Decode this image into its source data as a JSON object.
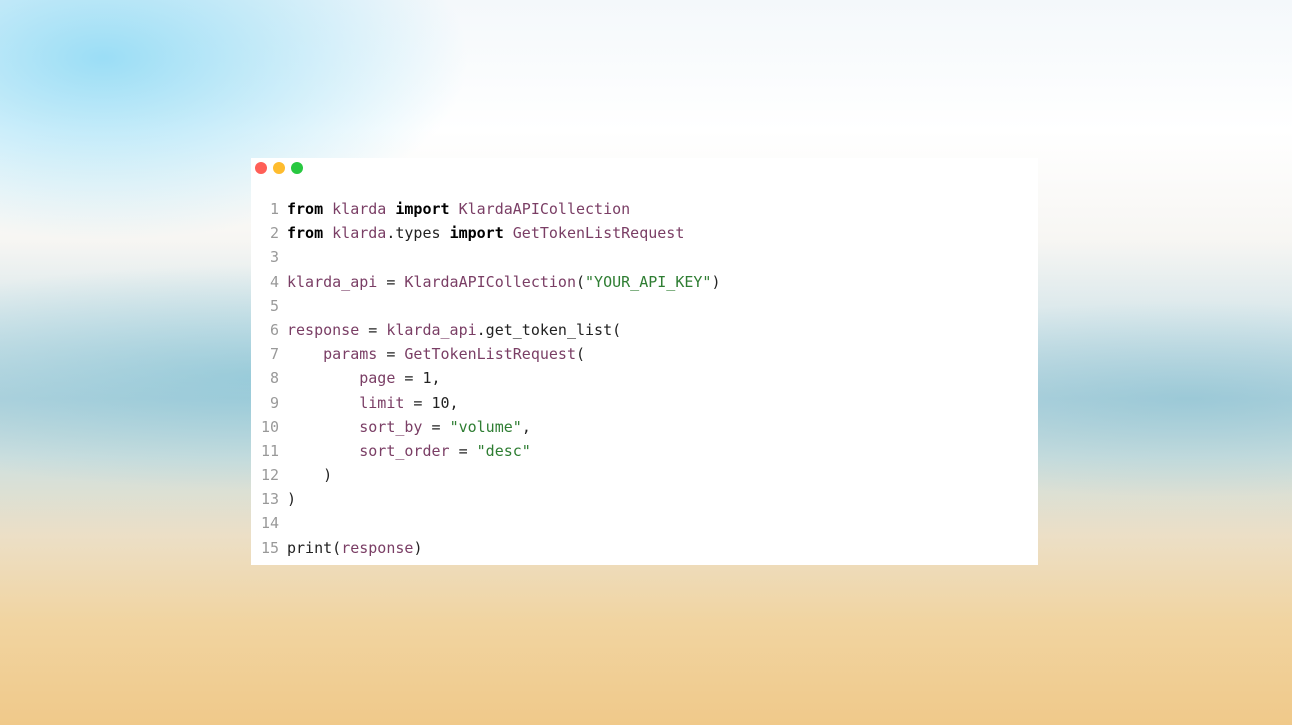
{
  "window": {
    "controls": [
      {
        "name": "close",
        "color": "#ff5f57"
      },
      {
        "name": "minimize",
        "color": "#febc2e"
      },
      {
        "name": "maximize",
        "color": "#28c840"
      }
    ]
  },
  "code": {
    "lines": [
      {
        "n": "1",
        "tokens": [
          [
            "kw",
            "from"
          ],
          [
            "pl",
            " "
          ],
          [
            "id",
            "klarda"
          ],
          [
            "pl",
            " "
          ],
          [
            "kw",
            "import"
          ],
          [
            "pl",
            " "
          ],
          [
            "id",
            "KlardaAPICollection"
          ]
        ]
      },
      {
        "n": "2",
        "tokens": [
          [
            "kw",
            "from"
          ],
          [
            "pl",
            " "
          ],
          [
            "id",
            "klarda"
          ],
          [
            "pl",
            ".types "
          ],
          [
            "kw",
            "import"
          ],
          [
            "pl",
            " "
          ],
          [
            "id",
            "GetTokenListRequest"
          ]
        ]
      },
      {
        "n": "3",
        "tokens": []
      },
      {
        "n": "4",
        "tokens": [
          [
            "id",
            "klarda_api"
          ],
          [
            "pl",
            " = "
          ],
          [
            "id",
            "KlardaAPICollection"
          ],
          [
            "pl",
            "("
          ],
          [
            "str",
            "\"YOUR_API_KEY\""
          ],
          [
            "pl",
            ")"
          ]
        ]
      },
      {
        "n": "5",
        "tokens": []
      },
      {
        "n": "6",
        "tokens": [
          [
            "id",
            "response"
          ],
          [
            "pl",
            " = "
          ],
          [
            "id",
            "klarda_api"
          ],
          [
            "pl",
            ".get_token_list("
          ]
        ]
      },
      {
        "n": "7",
        "tokens": [
          [
            "pl",
            "    "
          ],
          [
            "id",
            "params"
          ],
          [
            "pl",
            " = "
          ],
          [
            "id",
            "GetTokenListRequest"
          ],
          [
            "pl",
            "("
          ]
        ]
      },
      {
        "n": "8",
        "tokens": [
          [
            "pl",
            "        "
          ],
          [
            "id",
            "page"
          ],
          [
            "pl",
            " = 1,"
          ]
        ]
      },
      {
        "n": "9",
        "tokens": [
          [
            "pl",
            "        "
          ],
          [
            "id",
            "limit"
          ],
          [
            "pl",
            " = 10,"
          ]
        ]
      },
      {
        "n": "10",
        "tokens": [
          [
            "pl",
            "        "
          ],
          [
            "id",
            "sort_by"
          ],
          [
            "pl",
            " = "
          ],
          [
            "str",
            "\"volume\""
          ],
          [
            "pl",
            ","
          ]
        ]
      },
      {
        "n": "11",
        "tokens": [
          [
            "pl",
            "        "
          ],
          [
            "id",
            "sort_order"
          ],
          [
            "pl",
            " = "
          ],
          [
            "str",
            "\"desc\""
          ]
        ]
      },
      {
        "n": "12",
        "tokens": [
          [
            "pl",
            "    )"
          ]
        ]
      },
      {
        "n": "13",
        "tokens": [
          [
            "pl",
            ")"
          ]
        ]
      },
      {
        "n": "14",
        "tokens": []
      },
      {
        "n": "15",
        "tokens": [
          [
            "pl",
            "print("
          ],
          [
            "id",
            "response"
          ],
          [
            "pl",
            ")"
          ]
        ]
      }
    ]
  }
}
